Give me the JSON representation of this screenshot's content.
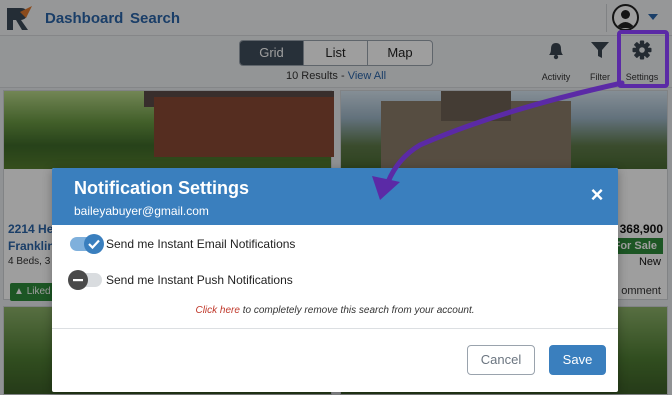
{
  "nav": {
    "dashboard_label": "Dashboard",
    "search_label": "Search"
  },
  "view_toggle": {
    "grid_label": "Grid",
    "list_label": "List",
    "map_label": "Map",
    "active": "Grid"
  },
  "results": {
    "count_text": "10 Results - ",
    "view_all_label": "View All"
  },
  "tools": {
    "activity_label": "Activity",
    "filter_label": "Filter",
    "settings_label": "Settings"
  },
  "listing_left": {
    "address": "2214 He",
    "city": "Franklin",
    "beds": "4 Beds, 3",
    "liked_label": "Liked"
  },
  "listing_right": {
    "price": "368,900",
    "status_badge": "For Sale",
    "new_label": "New",
    "comment_label": "omment"
  },
  "modal": {
    "title": "Notification Settings",
    "email": "baileyabuyer@gmail.com",
    "close_glyph": "×",
    "email_toggle_label": "Send me Instant Email Notifications",
    "email_toggle_state": "on",
    "push_toggle_label": "Send me Instant Push Notifications",
    "push_toggle_state": "off",
    "remove_link_text": "Click here",
    "remove_rest_text": " to completely remove this search from your account.",
    "cancel_label": "Cancel",
    "save_label": "Save"
  },
  "colors": {
    "brand_blue": "#3a7fbe",
    "annotation_purple": "#5b2aa6",
    "for_sale_green": "#2e8b3a"
  }
}
